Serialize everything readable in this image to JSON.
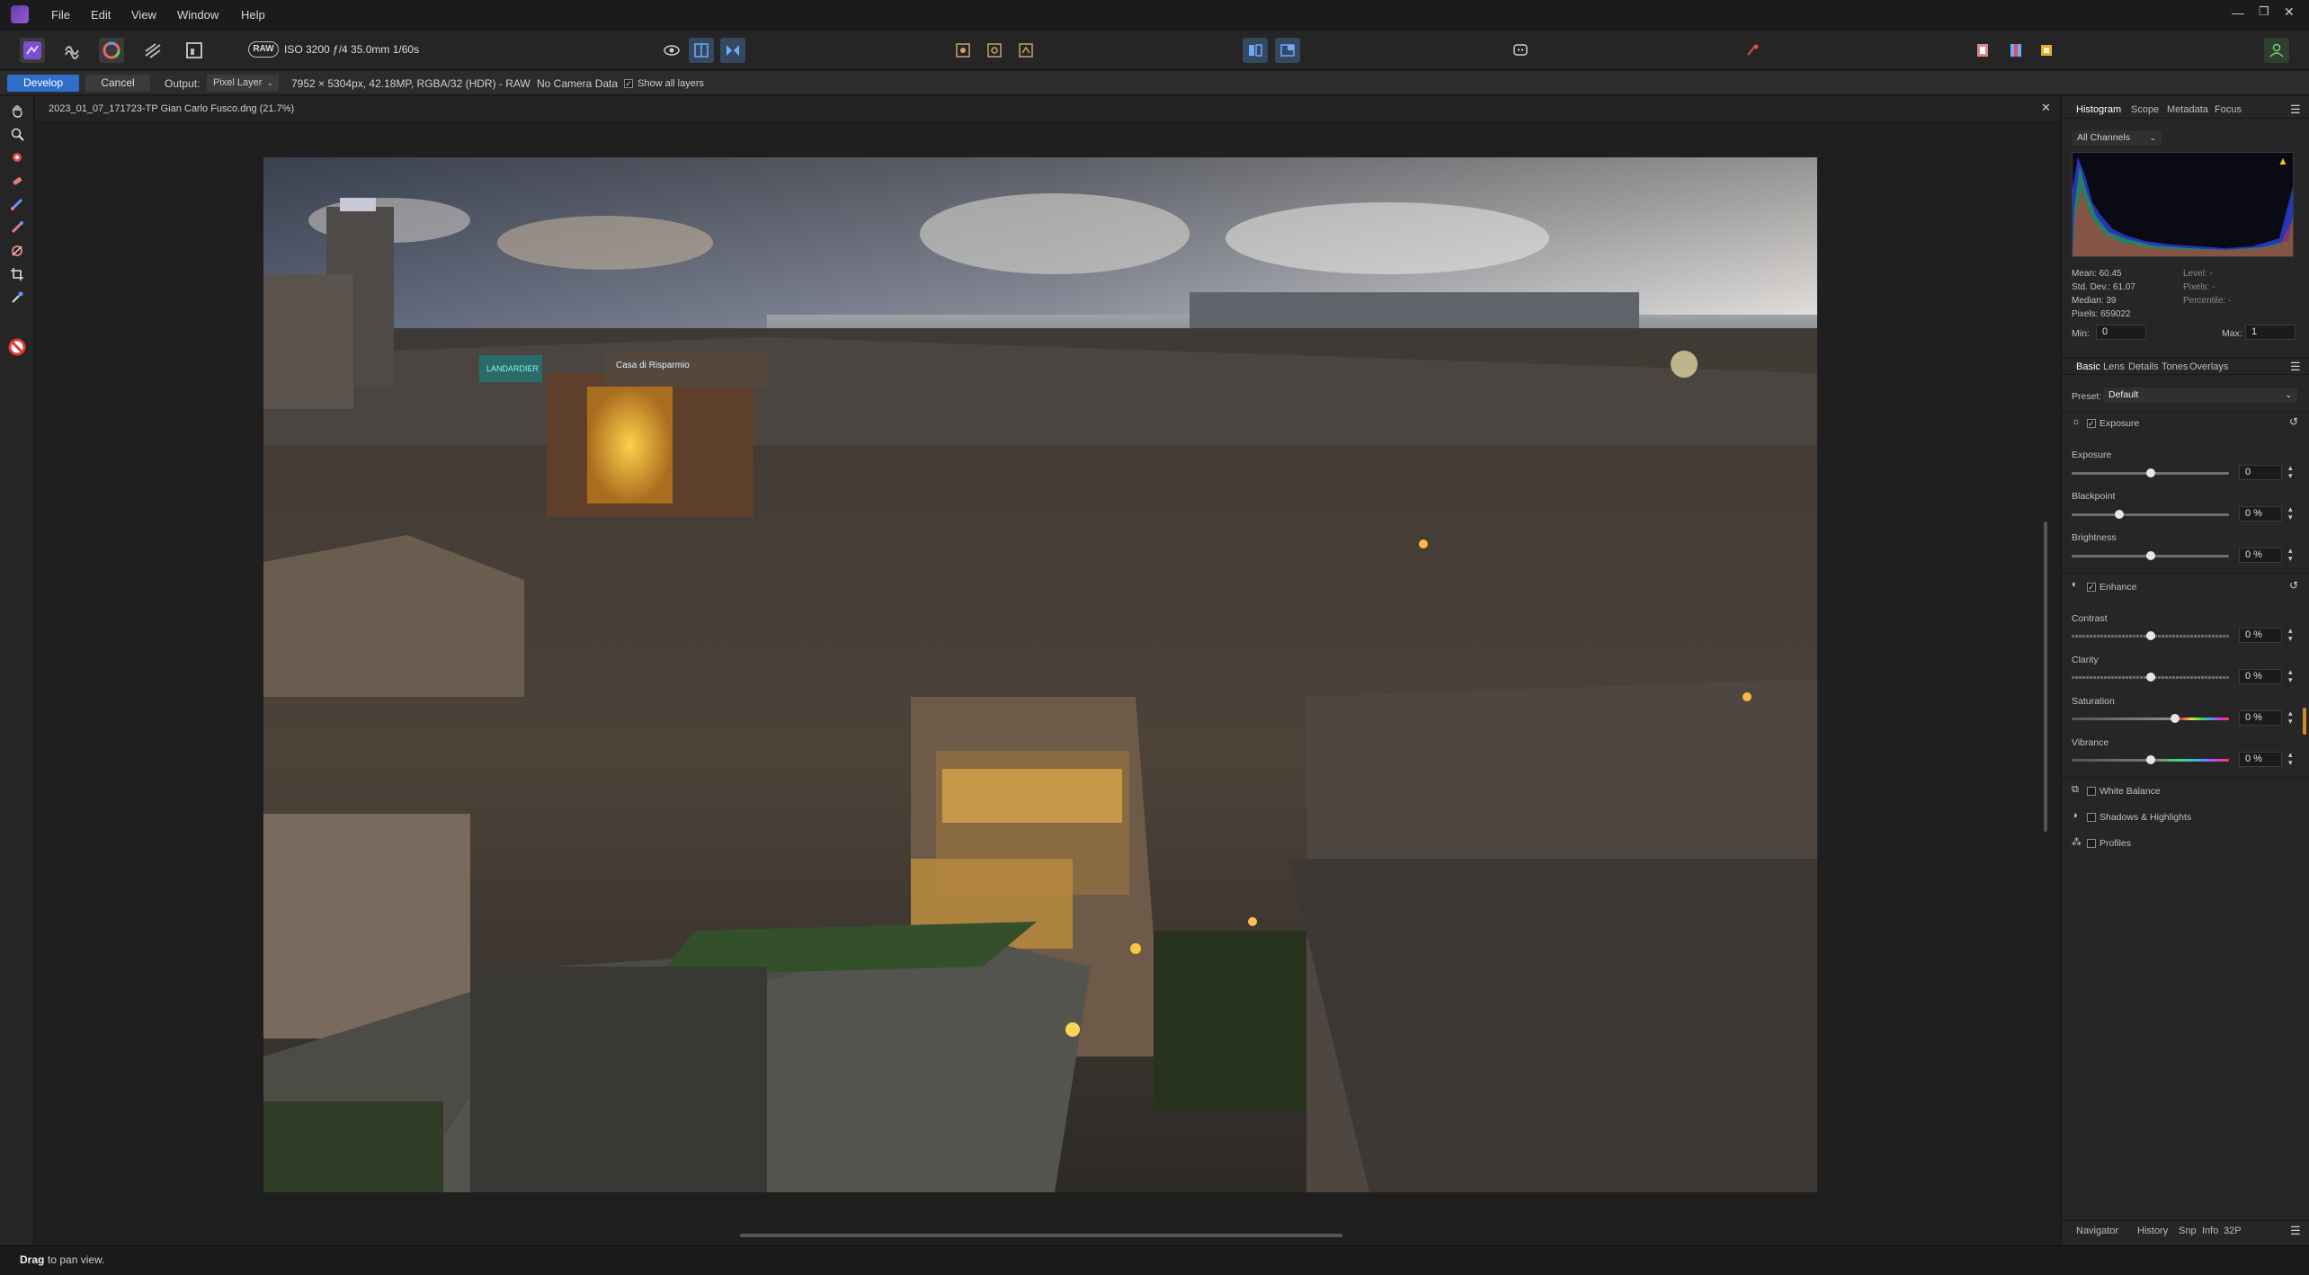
{
  "menu": [
    "File",
    "Edit",
    "View",
    "Window",
    "Help"
  ],
  "toolbar": {
    "raw_badge": "RAW",
    "exif": "ISO 3200 ƒ/4 35.0mm 1/60s"
  },
  "context": {
    "develop_label": "Develop",
    "cancel_label": "Cancel",
    "output_label": "Output:",
    "output_value": "Pixel Layer",
    "image_info": "7952 × 5304px, 42.18MP, RGBA/32 (HDR) - RAW",
    "camera_data": "No Camera Data",
    "show_all_layers": "Show all layers"
  },
  "document": {
    "title": "2023_01_07_171723-TP Gian Carlo Fusco.dng (21.7%)",
    "sign1": "Casa di Risparmio",
    "sign2": "LANDARDIER"
  },
  "histogram_panel": {
    "tabs": [
      "Histogram",
      "Scope",
      "Metadata",
      "Focus"
    ],
    "channel": "All Channels",
    "stats_left": [
      "Mean: 60.45",
      "Std. Dev.: 61.07",
      "Median: 39",
      "Pixels: 659022"
    ],
    "stats_right": [
      "Level: -",
      "Pixels: -",
      "Percentile: -"
    ],
    "min_label": "Min:",
    "min_value": "0",
    "max_label": "Max:",
    "max_value": "1"
  },
  "develop_panel": {
    "tabs": [
      "Basic",
      "Lens",
      "Details",
      "Tones",
      "Overlays"
    ],
    "preset_label": "Preset:",
    "preset_value": "Default",
    "exposure_group": "Exposure",
    "exposure_label": "Exposure",
    "exposure_value": "0",
    "blackpoint_label": "Blackpoint",
    "blackpoint_value": "0 %",
    "brightness_label": "Brightness",
    "brightness_value": "0 %",
    "enhance_group": "Enhance",
    "contrast_label": "Contrast",
    "contrast_value": "0 %",
    "clarity_label": "Clarity",
    "clarity_value": "0 %",
    "saturation_label": "Saturation",
    "saturation_value": "0 %",
    "vibrance_label": "Vibrance",
    "vibrance_value": "0 %",
    "white_balance": "White Balance",
    "shadows_highlights": "Shadows & Highlights",
    "profiles": "Profiles"
  },
  "bottom_panel": {
    "tabs": [
      "Navigator",
      "History",
      "Snp",
      "Info",
      "32P"
    ]
  },
  "status": {
    "bold": "Drag",
    "text": " to pan view."
  },
  "colors": {
    "accent": "#2f6fc9",
    "histogram_bg": "#0a0a14"
  }
}
